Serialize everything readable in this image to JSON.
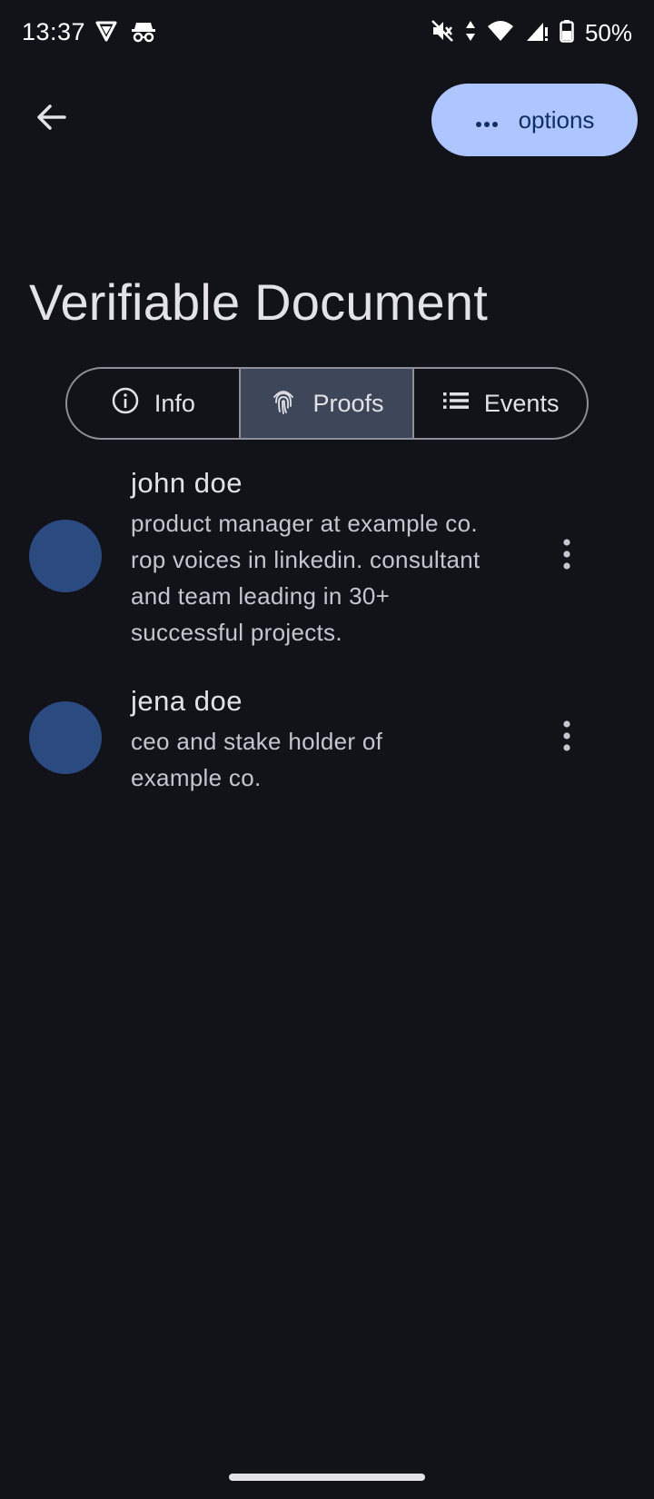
{
  "status_bar": {
    "time": "13:37",
    "battery": "50%",
    "icons": [
      "vpn-shield-icon",
      "incognito-icon",
      "mute-icon",
      "data-arrows-icon",
      "wifi-icon",
      "signal-icon",
      "battery-icon"
    ]
  },
  "app_bar": {
    "back_icon": "arrow-back-icon",
    "options_label": "options",
    "options_icon": "more-horiz-icon"
  },
  "page": {
    "title": "Verifiable Document"
  },
  "tabs": [
    {
      "label": "Info",
      "icon": "info-icon",
      "selected": false
    },
    {
      "label": "Proofs",
      "icon": "fingerprint-icon",
      "selected": true
    },
    {
      "label": "Events",
      "icon": "list-icon",
      "selected": false
    }
  ],
  "proofs": [
    {
      "name": "john doe",
      "description": "product manager at example co. rop voices in linkedin. consultant and team leading in 30+ successful projects."
    },
    {
      "name": "jena doe",
      "description": "ceo and stake holder of example co."
    }
  ],
  "colors": {
    "background": "#111318",
    "accent": "#adc6ff",
    "avatar": "#2a4a80",
    "selected_segment": "#3e4759"
  }
}
